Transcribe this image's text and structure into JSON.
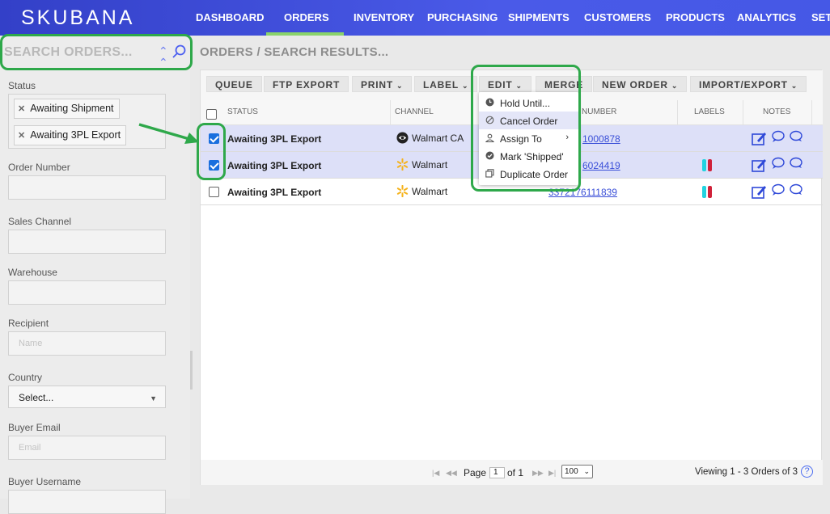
{
  "app": {
    "logo": "SKUBANA"
  },
  "nav": {
    "items": [
      "DASHBOARD",
      "ORDERS",
      "INVENTORY",
      "PURCHASING",
      "SHIPMENTS",
      "CUSTOMERS",
      "PRODUCTS",
      "ANALYTICS",
      "SET"
    ],
    "active": "ORDERS"
  },
  "search": {
    "placeholder": "SEARCH ORDERS..."
  },
  "filters": {
    "status_label": "Status",
    "status_tags": [
      "Awaiting Shipment",
      "Awaiting 3PL Export"
    ],
    "order_number_label": "Order Number",
    "sales_channel_label": "Sales Channel",
    "warehouse_label": "Warehouse",
    "recipient_label": "Recipient",
    "recipient_placeholder": "Name",
    "country_label": "Country",
    "country_value": "Select...",
    "buyer_email_label": "Buyer Email",
    "buyer_email_placeholder": "Email",
    "buyer_username_label": "Buyer Username"
  },
  "breadcrumb": "ORDERS / SEARCH RESULTS...",
  "toolbar": {
    "queue": "QUEUE",
    "ftp_export": "FTP EXPORT",
    "print": "PRINT",
    "label": "LABEL",
    "edit": "EDIT",
    "merge": "MERGE",
    "new_order": "NEW ORDER",
    "import_export": "IMPORT/EXPORT"
  },
  "table": {
    "headers": {
      "status": "STATUS",
      "channel": "CHANNEL",
      "number": "NUMBER",
      "labels": "LABELS",
      "notes": "NOTES"
    },
    "rows": [
      {
        "selected": true,
        "status": "Awaiting 3PL Export",
        "channel": "Walmart CA",
        "number": "1000878",
        "labels": false
      },
      {
        "selected": true,
        "status": "Awaiting 3PL Export",
        "channel": "Walmart",
        "number": "6024419",
        "labels": true
      },
      {
        "selected": false,
        "status": "Awaiting 3PL Export",
        "channel": "Walmart",
        "number": "3372176111839",
        "labels": true
      }
    ]
  },
  "edit_menu": [
    "Hold Until...",
    "Cancel Order",
    "Assign To",
    "Mark 'Shipped'",
    "Duplicate Order"
  ],
  "pager": {
    "page_label": "Page",
    "page_value": "1",
    "of_label": "of 1",
    "per_page": "100",
    "viewing": "Viewing 1 - 3 Orders of 3",
    "help": "?"
  },
  "colors": {
    "nav_bg": "#3f4fe0",
    "active_underline": "#8ad36b",
    "highlight_box": "#2ea84a",
    "link": "#3a4fd8",
    "label_cyan": "#22d3e0",
    "label_red": "#d0213a"
  }
}
